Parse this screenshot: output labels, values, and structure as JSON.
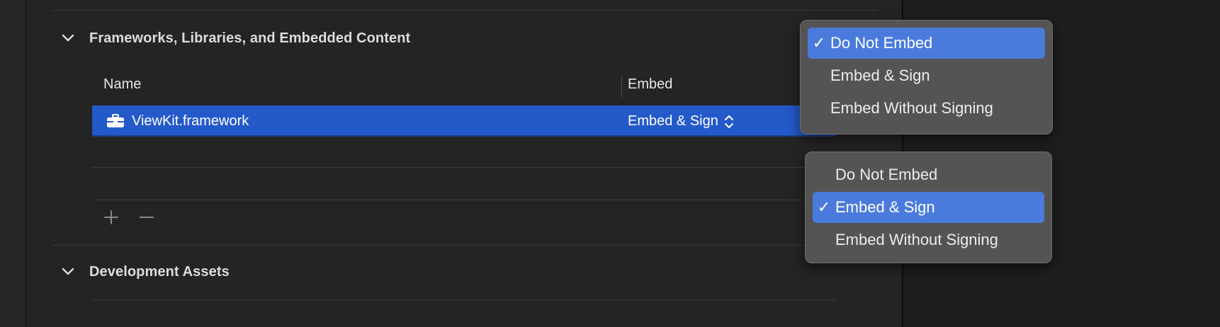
{
  "sections": {
    "frameworks": {
      "title": "Frameworks, Libraries, and Embedded Content",
      "columns": {
        "name": "Name",
        "embed": "Embed"
      },
      "rows": [
        {
          "name": "ViewKit.framework",
          "embed": "Embed & Sign",
          "icon": "toolbox-icon",
          "selected": true
        }
      ],
      "add_label": "+",
      "remove_label": "−"
    },
    "dev_assets": {
      "title": "Development Assets"
    }
  },
  "menu_top": {
    "items": [
      {
        "label": "Do Not Embed",
        "checked": true,
        "check": "✓"
      },
      {
        "label": "Embed & Sign",
        "checked": false
      },
      {
        "label": "Embed Without Signing",
        "checked": false
      }
    ]
  },
  "menu_bottom": {
    "items": [
      {
        "label": "Do Not Embed",
        "checked": false
      },
      {
        "label": "Embed & Sign",
        "checked": true,
        "check": "✓"
      },
      {
        "label": "Embed Without Signing",
        "checked": false
      }
    ]
  },
  "colors": {
    "selection": "#2459c9",
    "menu_highlight": "#4a7bdc",
    "menu_bg": "#545454",
    "panel_bg": "#242424"
  }
}
